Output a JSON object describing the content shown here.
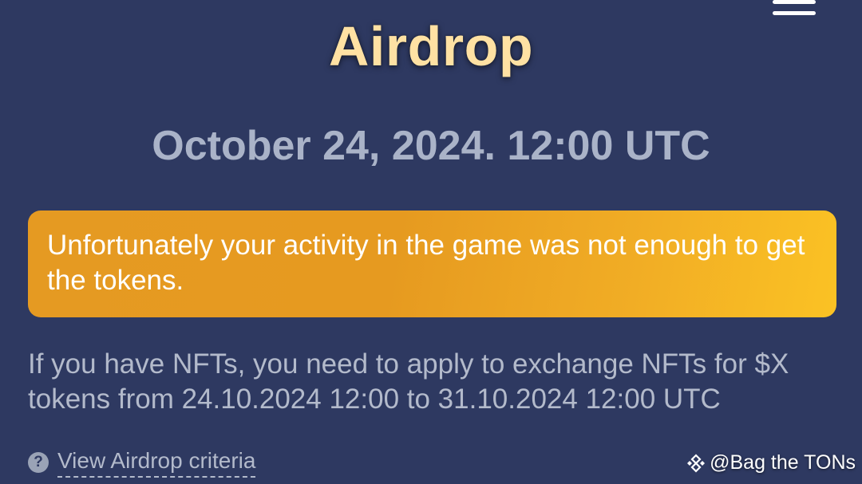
{
  "header": {
    "title": "Airdrop",
    "menu_icon": "hamburger-menu-icon"
  },
  "date_text": "October 24, 2024. 12:00 UTC",
  "alert": {
    "text": "Unfortunately your activity in the game was not enough to get the tokens.",
    "colors": [
      "#e59a22",
      "#fbc224"
    ]
  },
  "info_text": "If you have NFTs, you need to apply to exchange NFTs for $X tokens from 24.10.2024 12:00 to 31.10.2024 12:00 UTC",
  "criteria": {
    "icon": "question-circle-icon",
    "icon_glyph": "?",
    "link_label": "View Airdrop criteria"
  },
  "watermark": {
    "icon": "binance-logo-icon",
    "text": "@Bag the TONs"
  },
  "colors": {
    "background": "#2e3961",
    "title": "#ffe1a3",
    "muted_text": "#b3bacb"
  }
}
